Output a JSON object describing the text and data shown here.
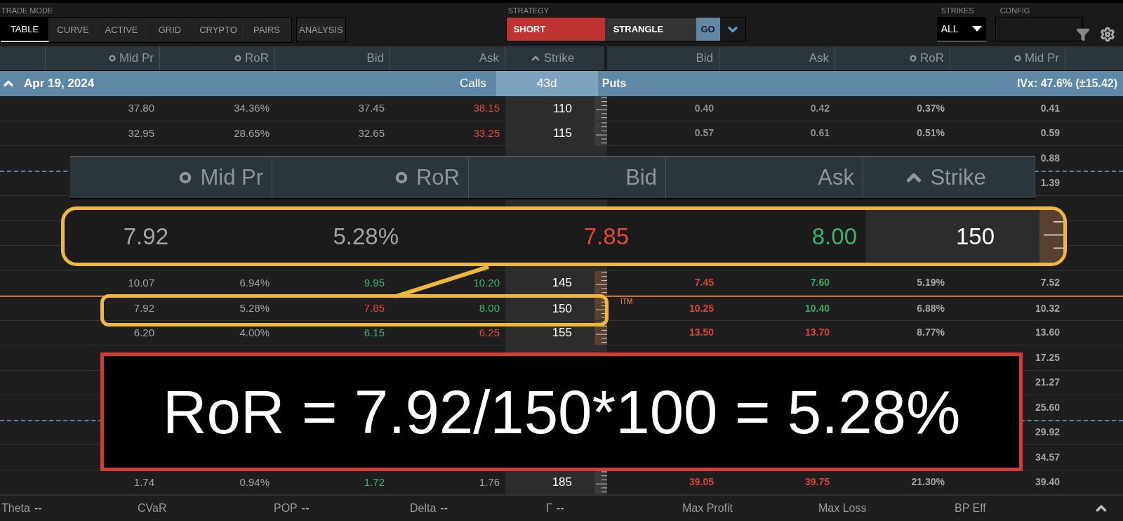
{
  "trade_mode": {
    "label": "TRADE MODE",
    "tabs": [
      {
        "label": "TABLE",
        "selected": true
      },
      {
        "label": "CURVE",
        "selected": false
      },
      {
        "label": "ACTIVE",
        "selected": false
      },
      {
        "label": "GRID",
        "selected": false
      },
      {
        "label": "CRYPTO",
        "selected": false
      },
      {
        "label": "PAIRS",
        "selected": false
      }
    ],
    "analysis_button": "ANALYSIS"
  },
  "strategy": {
    "label": "STRATEGY",
    "side": "SHORT",
    "type": "STRANGLE",
    "go": "GO"
  },
  "strikes": {
    "label": "STRIKES",
    "value": "ALL"
  },
  "config": {
    "label": "CONFIG"
  },
  "calls_columns": [
    {
      "label": "Mid Pr",
      "kind": "toggle"
    },
    {
      "label": "RoR",
      "kind": "toggle"
    },
    {
      "label": "Bid",
      "kind": "plain"
    },
    {
      "label": "Ask",
      "kind": "plain"
    }
  ],
  "strike_column": {
    "label": "Strike",
    "kind": "sorted"
  },
  "puts_columns": [
    {
      "label": "Bid",
      "kind": "plain"
    },
    {
      "label": "Ask",
      "kind": "plain"
    },
    {
      "label": "RoR",
      "kind": "toggle"
    },
    {
      "label": "Mid Pr",
      "kind": "toggle"
    }
  ],
  "expiration": {
    "date": "Apr 19, 2024",
    "calls_label": "Calls",
    "days": "43d",
    "puts_label": "Puts",
    "ivx": "IVx: 47.6% (±15.42)"
  },
  "rows": [
    {
      "strike": "110",
      "itm": false,
      "sd_line": false,
      "calls": {
        "mid": "37.80",
        "ror": "34.36%",
        "bid": {
          "value": "37.45",
          "color": "#a3a3a3"
        },
        "ask": {
          "value": "38.15",
          "color": "#e5473c"
        }
      },
      "puts": {
        "bid": {
          "value": "0.40",
          "color": "#8f8f8f"
        },
        "ask": {
          "value": "0.42",
          "color": "#8f8f8f"
        },
        "ror": "0.37%",
        "mid": "0.41"
      }
    },
    {
      "strike": "115",
      "itm": false,
      "sd_line": false,
      "calls": {
        "mid": "32.95",
        "ror": "28.65%",
        "bid": {
          "value": "32.65",
          "color": "#a3a3a3"
        },
        "ask": {
          "value": "33.25",
          "color": "#e5473c"
        }
      },
      "puts": {
        "bid": {
          "value": "0.57",
          "color": "#8f8f8f"
        },
        "ask": {
          "value": "0.61",
          "color": "#8f8f8f"
        },
        "ror": "0.51%",
        "mid": "0.59"
      }
    },
    {
      "sd_line": false,
      "calls": {},
      "puts": {
        "mid": "0.88"
      }
    },
    {
      "sd_line": true,
      "calls": {},
      "puts": {
        "mid": "1.39"
      }
    },
    {
      "sd_line": false,
      "calls": {},
      "puts": {}
    },
    {
      "sd_line": false,
      "calls": {},
      "puts": {}
    },
    {
      "sd_line": false,
      "calls": {},
      "puts": {}
    },
    {
      "strike": "145",
      "itm": true,
      "sd_line": false,
      "calls": {
        "mid": "10.07",
        "ror": "6.94%",
        "bid": {
          "value": "9.95",
          "color": "#3cb46a"
        },
        "ask": {
          "value": "10.20",
          "color": "#3cb46a"
        }
      },
      "puts": {
        "bid": {
          "value": "7.45",
          "color": "#d8443a"
        },
        "ask": {
          "value": "7.60",
          "color": "#3aa863"
        },
        "ror": "5.19%",
        "mid": "7.52"
      }
    },
    {
      "strike": "150",
      "itm": true,
      "sd_line": false,
      "price_label": "ITM",
      "calls": {
        "mid": "7.92",
        "ror": "5.28%",
        "bid": {
          "value": "7.85",
          "color": "#e5473c"
        },
        "ask": {
          "value": "8.00",
          "color": "#3cb46a"
        }
      },
      "puts": {
        "bid": {
          "value": "10.25",
          "color": "#d8443a"
        },
        "ask": {
          "value": "10.40",
          "color": "#3aa863"
        },
        "ror": "6.88%",
        "mid": "10.32"
      }
    },
    {
      "strike": "155",
      "itm": true,
      "sd_line": false,
      "calls": {
        "mid": "6.20",
        "ror": "4.00%",
        "bid": {
          "value": "6.15",
          "color": "#3cb46a"
        },
        "ask": {
          "value": "6.25",
          "color": "#e5473c"
        }
      },
      "puts": {
        "bid": {
          "value": "13.50",
          "color": "#d8443a"
        },
        "ask": {
          "value": "13.70",
          "color": "#d8443a"
        },
        "ror": "8.77%",
        "mid": "13.60"
      }
    },
    {
      "sd_line": false,
      "calls": {},
      "puts": {
        "mid": "17.25"
      }
    },
    {
      "sd_line": false,
      "calls": {},
      "puts": {
        "mid": "21.27"
      }
    },
    {
      "sd_line": false,
      "calls": {},
      "puts": {
        "mid": "25.60"
      }
    },
    {
      "sd_line": true,
      "calls": {},
      "puts": {
        "mid": "29.92"
      }
    },
    {
      "sd_line": false,
      "calls": {},
      "puts": {
        "mid": "34.57"
      }
    },
    {
      "strike": "185",
      "itm": false,
      "sd_line": false,
      "calls": {
        "mid": "1.74",
        "ror": "0.94%",
        "bid": {
          "value": "1.72",
          "color": "#3cb46a"
        },
        "ask": {
          "value": "1.76",
          "color": "#a3a3a3"
        }
      },
      "puts": {
        "bid": {
          "value": "39.05",
          "color": "#d8443a"
        },
        "ask": {
          "value": "39.75",
          "color": "#d8443a"
        },
        "ror": "21.30%",
        "mid": "39.40"
      }
    }
  ],
  "callout": {
    "columns": [
      {
        "label": "Mid Pr",
        "kind": "toggle"
      },
      {
        "label": "RoR",
        "kind": "toggle"
      },
      {
        "label": "Bid",
        "kind": "plain"
      },
      {
        "label": "Ask",
        "kind": "plain"
      },
      {
        "label": "Strike",
        "kind": "sorted"
      }
    ],
    "row": {
      "mid": "7.92",
      "ror": "5.28%",
      "bid": {
        "value": "7.85",
        "color": "#e5473c"
      },
      "ask": {
        "value": "8.00",
        "color": "#3cb46a"
      },
      "strike": "150"
    }
  },
  "formula": "RoR = 7.92/150*100 = 5.28%",
  "status_bar": [
    {
      "label": "Theta",
      "value": "--"
    },
    {
      "label": "CVaR"
    },
    {
      "label": "POP",
      "value": "--"
    },
    {
      "label": "Delta",
      "value": "--"
    },
    {
      "label": "Γ",
      "value": "--"
    },
    {
      "label": "Max Profit"
    },
    {
      "label": "Max Loss"
    },
    {
      "label": "BP Eff"
    }
  ]
}
